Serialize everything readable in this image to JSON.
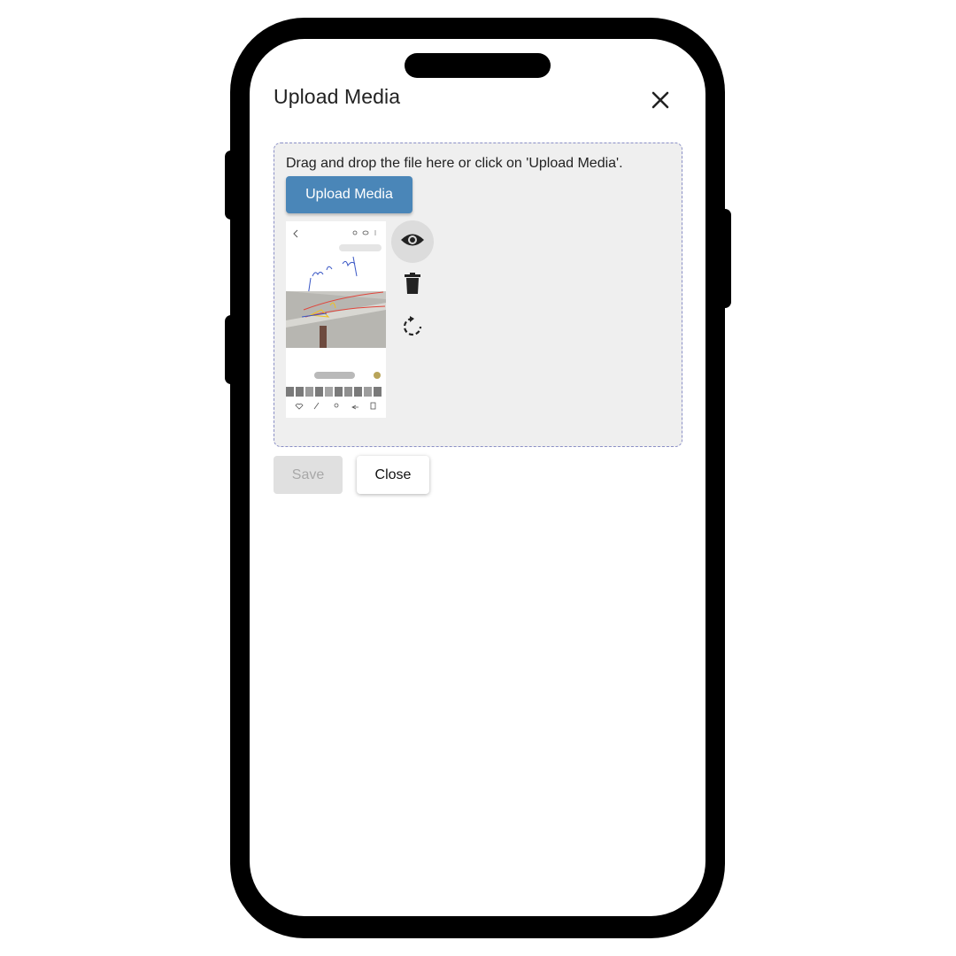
{
  "dialog": {
    "title": "Upload Media"
  },
  "dropzone": {
    "hint": "Drag and drop the file here or click on 'Upload Media'.",
    "upload_label": "Upload Media"
  },
  "preview": {
    "actions": [
      "eye-icon",
      "trash-icon",
      "rotate-icon"
    ]
  },
  "footer": {
    "save_label": "Save",
    "close_label": "Close"
  },
  "colors": {
    "primary": "#4a86b8",
    "dropzone_bg": "#efefef",
    "disabled_bg": "#e0e0e0"
  }
}
